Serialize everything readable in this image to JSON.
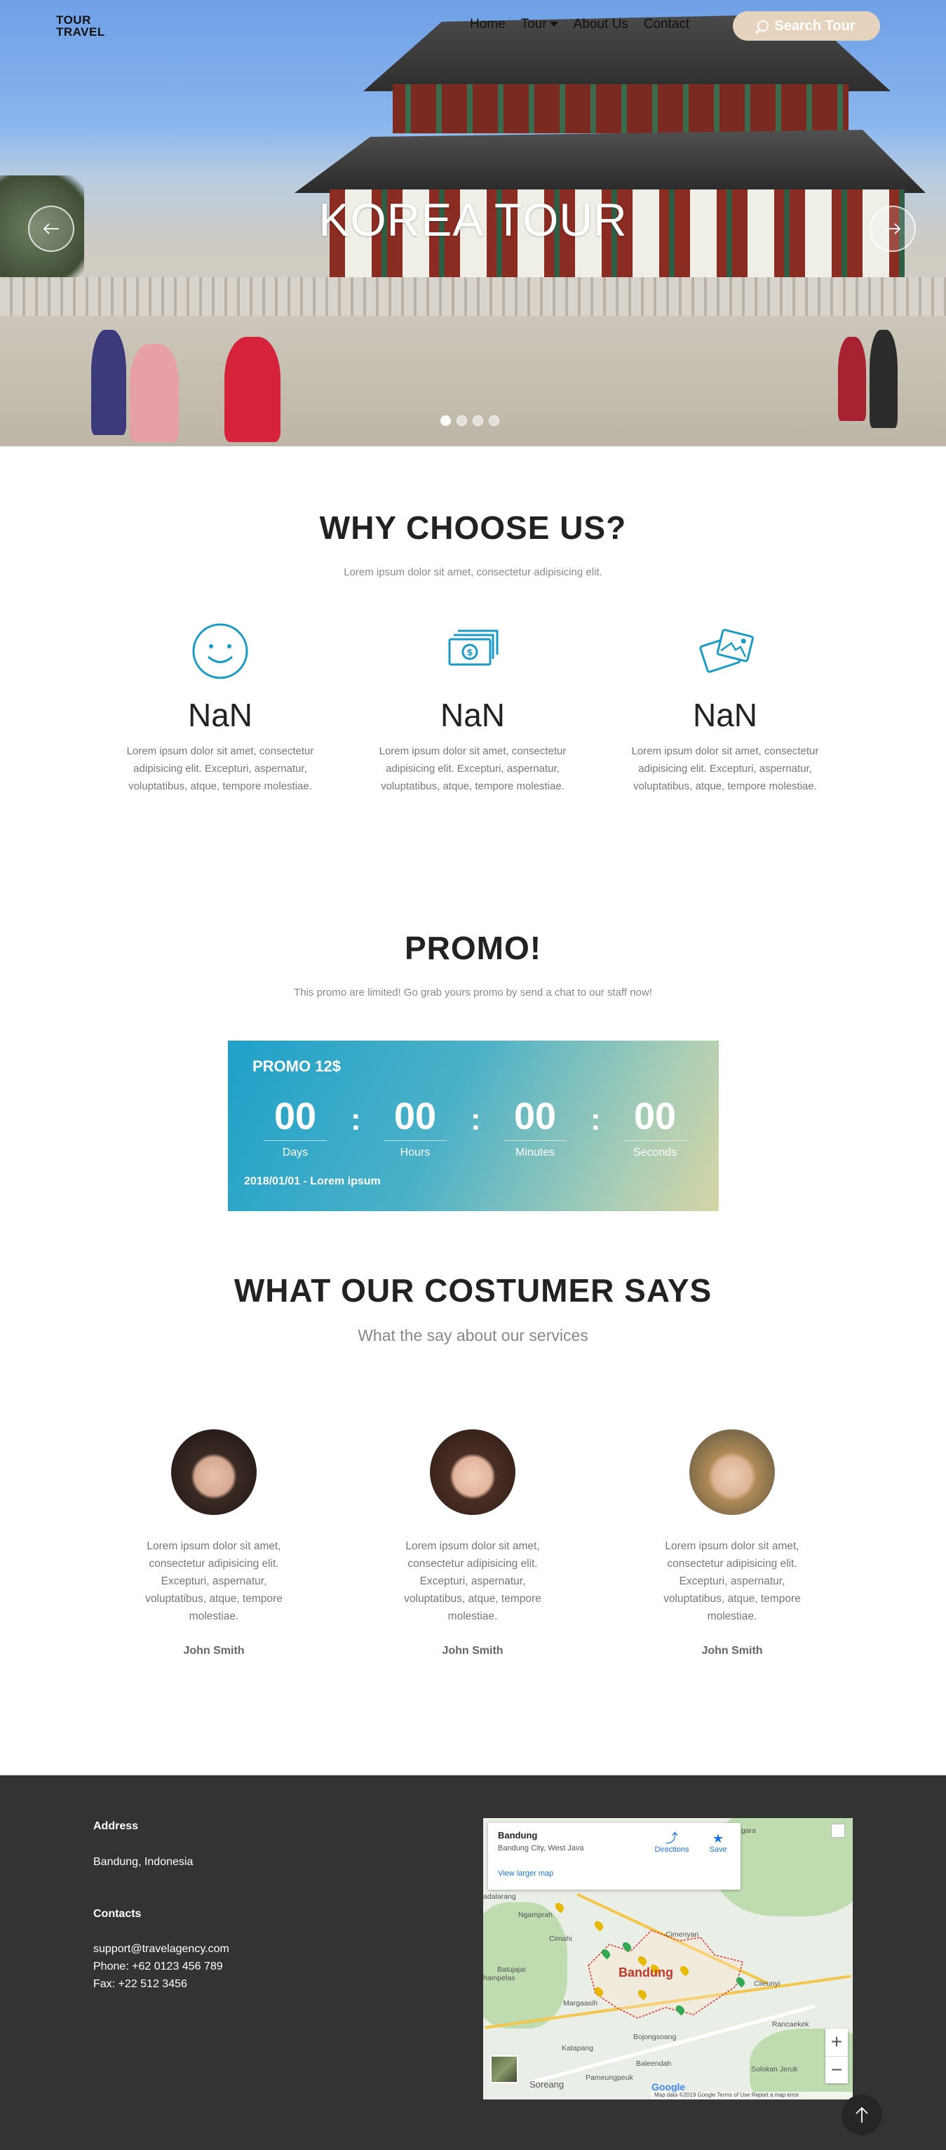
{
  "brand": {
    "line1": "TOUR",
    "line2": "TRAVEL"
  },
  "nav": {
    "items": [
      "Home",
      "Tour",
      "About Us",
      "Contact"
    ],
    "search_label": "Search Tour"
  },
  "hero": {
    "title": "KOREA TOUR",
    "slide_count": 4,
    "active_slide": 1
  },
  "why": {
    "title": "WHY CHOOSE US?",
    "subtitle": "Lorem ipsum dolor sit amet, consectetur adipisicing elit.",
    "features": [
      {
        "icon": "smiley-icon",
        "number": "NaN",
        "text": "Lorem ipsum dolor sit amet, consectetur adipisicing elit. Excepturi, aspernatur, voluptatibus, atque, tempore molestiae."
      },
      {
        "icon": "money-icon",
        "number": "NaN",
        "text": "Lorem ipsum dolor sit amet, consectetur adipisicing elit. Excepturi, aspernatur, voluptatibus, atque, tempore molestiae."
      },
      {
        "icon": "photos-icon",
        "number": "NaN",
        "text": "Lorem ipsum dolor sit amet, consectetur adipisicing elit. Excepturi, aspernatur, voluptatibus, atque, tempore molestiae."
      }
    ]
  },
  "promo": {
    "title": "PROMO!",
    "subtitle": "This promo are limited! Go grab yours promo by send a chat to our staff now!",
    "card_title": "PROMO 12$",
    "countdown": [
      {
        "value": "00",
        "label": "Days"
      },
      {
        "value": "00",
        "label": "Hours"
      },
      {
        "value": "00",
        "label": "Minutes"
      },
      {
        "value": "00",
        "label": "Seconds"
      }
    ],
    "separator": ":",
    "date_text": "2018/01/01 - Lorem ipsum",
    "accent": "#1fa1c9"
  },
  "testimonials": {
    "title": "WHAT OUR COSTUMER SAYS",
    "subtitle": "What the say about our services",
    "items": [
      {
        "text": "Lorem ipsum dolor sit amet, consectetur adipisicing elit. Excepturi, aspernatur, voluptatibus, atque, tempore molestiae.",
        "name": "John Smith"
      },
      {
        "text": "Lorem ipsum dolor sit amet, consectetur adipisicing elit. Excepturi, aspernatur, voluptatibus, atque, tempore molestiae.",
        "name": "John Smith"
      },
      {
        "text": "Lorem ipsum dolor sit amet, consectetur adipisicing elit. Excepturi, aspernatur, voluptatibus, atque, tempore molestiae.",
        "name": "John Smith"
      }
    ]
  },
  "footer": {
    "address_label": "Address",
    "address": "Bandung, Indonesia",
    "contacts_label": "Contacts",
    "email": "support@travelagency.com",
    "phone": "Phone: +62 0123 456 789",
    "fax": "Fax: +22 512 3456",
    "bg": "#333333"
  },
  "map": {
    "place": "Bandung",
    "region": "Bandung City, West Java",
    "larger_link": "View larger map",
    "directions": "Directions",
    "save": "Save",
    "city_label": "Bandung",
    "labels": [
      "Ngamprah",
      "Cimahi",
      "Cimenyan",
      "Batujajar",
      "Margaasih",
      "Cileunyi",
      "Rancaekek",
      "Bojongsoang",
      "Katapang",
      "Baleendah",
      "Solokan Jeruk",
      "Pameungpeuk",
      "Soreang",
      "agara",
      "adalarang",
      "hampelas"
    ],
    "google": "Google",
    "attribution": "Map data ©2019 Google   Terms of Use   Report a map error"
  }
}
